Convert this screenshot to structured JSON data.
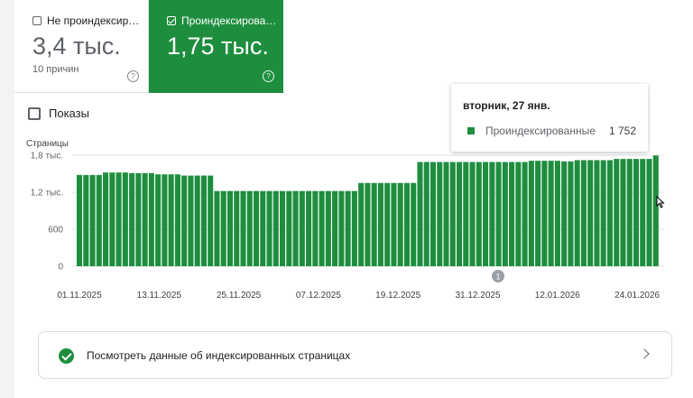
{
  "tiles": {
    "not_indexed": {
      "label": "Не проиндексир…",
      "value": "3,4 тыс.",
      "sub": "10 причин",
      "help": "?"
    },
    "indexed": {
      "label": "Проиндексирова…",
      "value": "1,75 тыс.",
      "help": "?"
    }
  },
  "impressions_label": "Показы",
  "tooltip": {
    "date": "вторник, 27 янв.",
    "series": "Проиндексированные",
    "value": "1 752"
  },
  "annotation_badge": "1",
  "link_card": {
    "text": "Посмотреть данные об индексированных страницах"
  },
  "colors": {
    "indexed": "#1e8e3e",
    "grid": "#e0e0e0"
  },
  "chart_data": {
    "type": "bar",
    "ylabel": "Страницы",
    "yticks": [
      "0",
      "600",
      "1,2 тыс.",
      "1,8 тыс."
    ],
    "ytick_values": [
      0,
      600,
      1200,
      1800
    ],
    "ylim": [
      0,
      1800
    ],
    "xtick_labels": [
      "01.11.2025",
      "13.11.2025",
      "25.11.2025",
      "07.12.2025",
      "19.12.2025",
      "31.12.2025",
      "12.01.2026",
      "24.01.2026"
    ],
    "series": [
      {
        "name": "Проиндексированные",
        "values": [
          1480,
          1480,
          1480,
          1480,
          1520,
          1520,
          1520,
          1520,
          1510,
          1510,
          1510,
          1510,
          1490,
          1490,
          1490,
          1490,
          1470,
          1470,
          1470,
          1470,
          1470,
          1220,
          1220,
          1220,
          1220,
          1220,
          1220,
          1220,
          1220,
          1220,
          1220,
          1220,
          1220,
          1220,
          1220,
          1220,
          1220,
          1220,
          1220,
          1220,
          1220,
          1220,
          1220,
          1350,
          1350,
          1350,
          1350,
          1350,
          1350,
          1350,
          1350,
          1350,
          1690,
          1690,
          1690,
          1690,
          1690,
          1690,
          1690,
          1690,
          1690,
          1690,
          1690,
          1690,
          1690,
          1690,
          1690,
          1690,
          1690,
          1710,
          1710,
          1710,
          1710,
          1710,
          1700,
          1700,
          1720,
          1720,
          1720,
          1720,
          1720,
          1720,
          1740,
          1740,
          1740,
          1740,
          1740,
          1740,
          1752
        ]
      }
    ]
  }
}
